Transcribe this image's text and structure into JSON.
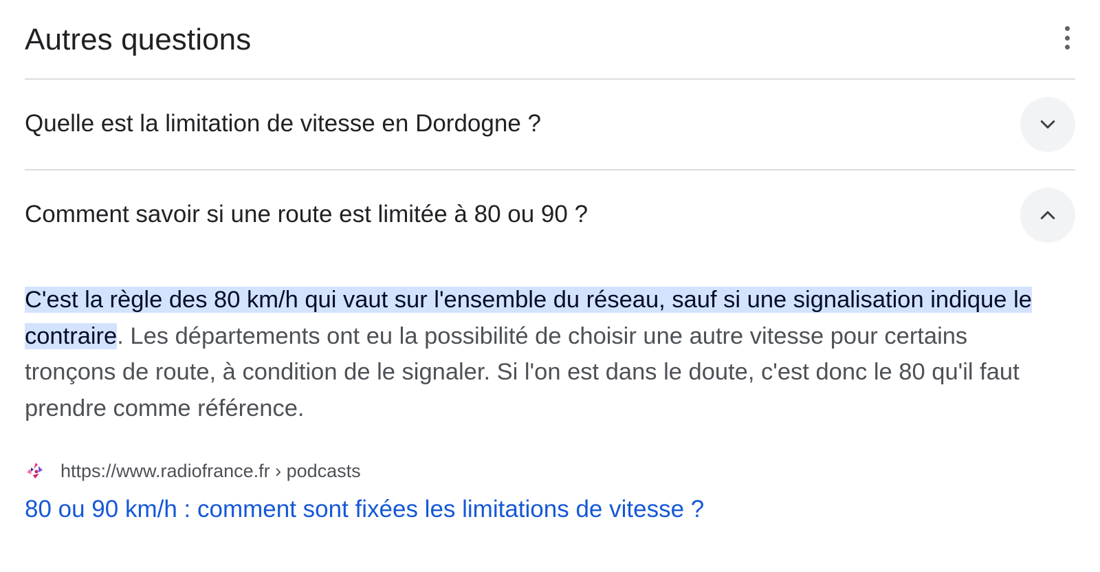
{
  "section": {
    "title": "Autres questions",
    "menu_icon": "more-vert-icon"
  },
  "questions": [
    {
      "text": "Quelle est la limitation de vitesse en Dordogne ?",
      "expanded": false,
      "icon": "chevron-down-icon"
    },
    {
      "text": "Comment savoir si une route est limitée à 80 ou 90 ?",
      "expanded": true,
      "icon": "chevron-up-icon"
    }
  ],
  "answer": {
    "highlight": "C'est la règle des 80 km/h qui vaut sur l'ensemble du réseau, sauf si une signalisation indique le contraire",
    "rest": ". Les départements ont eu la possibilité de choisir une autre vitesse pour certains tronçons de route, à condition de le signaler. Si l'on est dans le doute, c'est donc le 80 qu'il faut prendre comme référence."
  },
  "source": {
    "favicon": "radiofrance-logo-icon",
    "url": "https://www.radiofrance.fr › podcasts",
    "link_title": "80 ou 90 km/h : comment sont fixées les limitations de vitesse ?"
  },
  "colors": {
    "text": "#202124",
    "secondary_text": "#4d5156",
    "highlight_bg": "#d3e3fd",
    "link": "#1558d6",
    "divider": "#dadce0",
    "button_bg": "#f1f3f4"
  }
}
